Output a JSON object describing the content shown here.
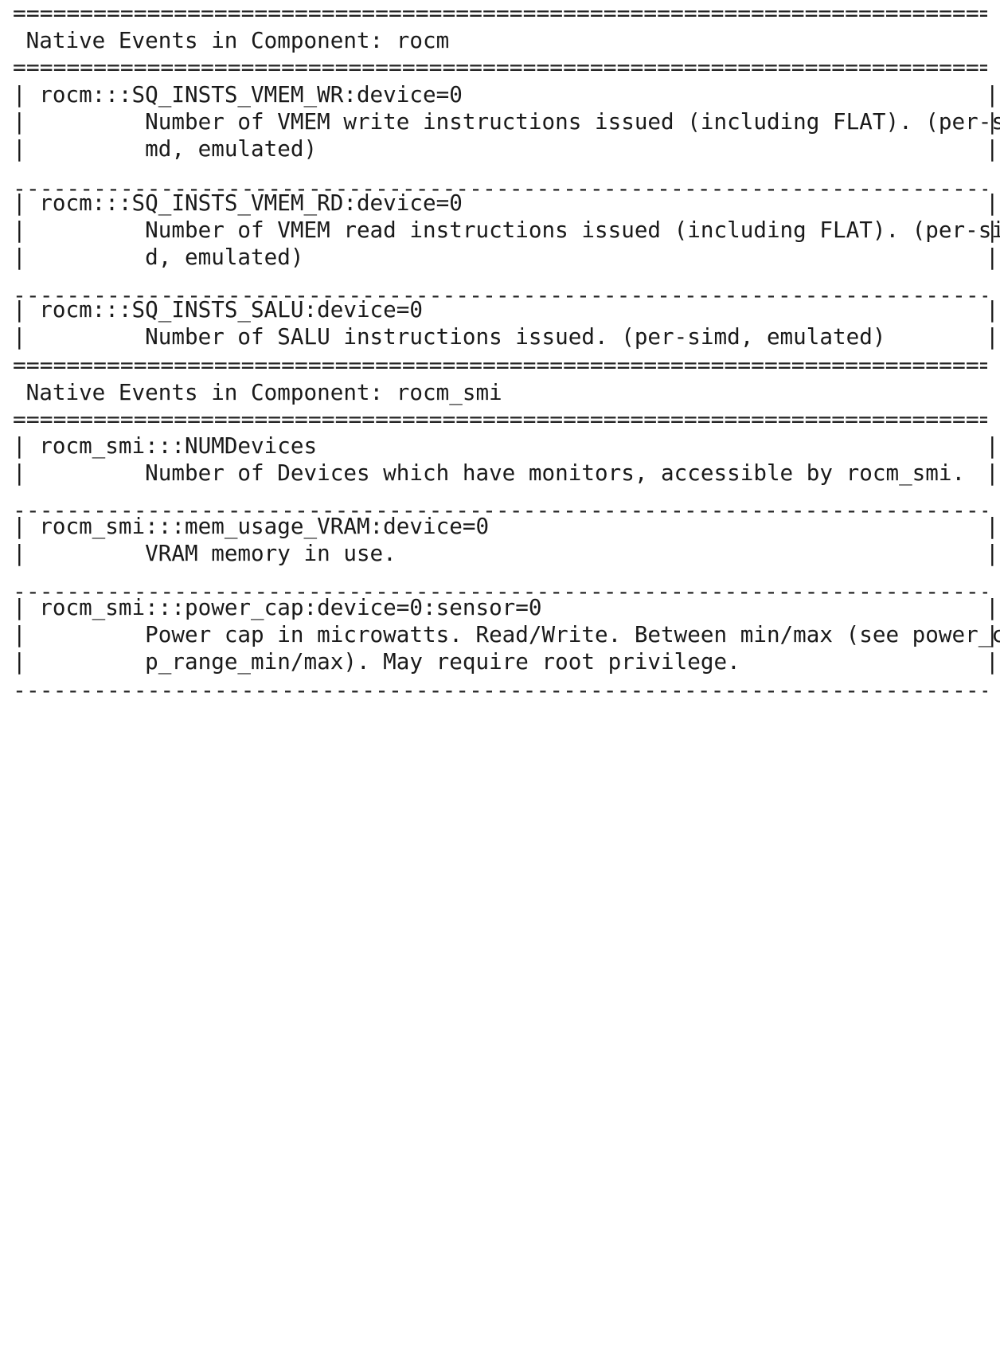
{
  "components": [
    {
      "header": " Native Events in Component: rocm",
      "events": [
        {
          "name": "rocm:::SQ_INSTS_VMEM_WR:device=0",
          "desc": [
            "Number of VMEM write instructions issued (including FLAT). (per-si",
            "md, emulated)"
          ]
        },
        {
          "name": "rocm:::SQ_INSTS_VMEM_RD:device=0",
          "desc": [
            "Number of VMEM read instructions issued (including FLAT). (per-sim",
            "d, emulated)"
          ]
        },
        {
          "name": "rocm:::SQ_INSTS_SALU:device=0",
          "desc": [
            "Number of SALU instructions issued. (per-simd, emulated)"
          ]
        }
      ]
    },
    {
      "header": " Native Events in Component: rocm_smi",
      "events": [
        {
          "name": "rocm_smi:::NUMDevices",
          "desc": [
            "Number of Devices which have monitors, accessible by rocm_smi."
          ]
        },
        {
          "name": "rocm_smi:::mem_usage_VRAM:device=0",
          "desc": [
            "VRAM memory in use."
          ]
        },
        {
          "name": "rocm_smi:::power_cap:device=0:sensor=0",
          "desc": [
            "Power cap in microwatts. Read/Write. Between min/max (see power_ca",
            "p_range_min/max). May require root privilege."
          ]
        }
      ]
    }
  ]
}
